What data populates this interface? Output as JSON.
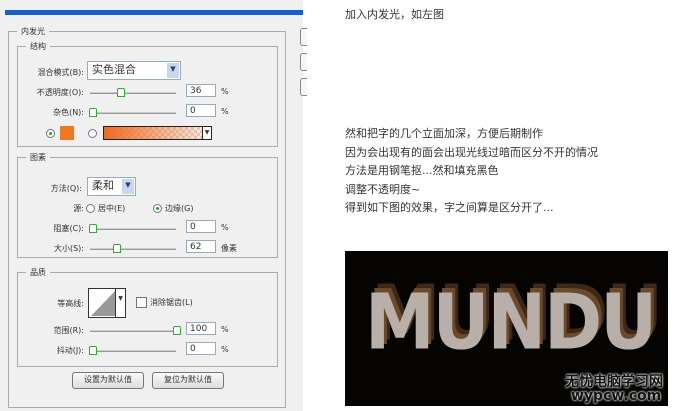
{
  "intro": "加入内发光，如左图",
  "dialog": {
    "title": "内发光",
    "structure": {
      "title": "结构",
      "blend_mode_label": "混合模式(B):",
      "blend_mode": "实色混合",
      "opacity_label": "不透明度(O):",
      "opacity": "36",
      "opacity_fraction": 0.36,
      "noise_label": "杂色(N):",
      "noise": "0",
      "unit": "%",
      "color": "#f07820"
    },
    "elements": {
      "title": "图素",
      "method_label": "方法(Q):",
      "method": "柔和",
      "source_label": "源:",
      "center_label": "居中(E)",
      "edge_label": "边缘(G)",
      "choke_label": "阻塞(C):",
      "choke": "0",
      "size_label": "大小(S):",
      "size": "62",
      "size_unit": "像素",
      "unit": "%"
    },
    "quality": {
      "title": "品质",
      "contour_label": "等高线:",
      "antialias_label": "消除锯齿(L)",
      "range_label": "范围(R):",
      "range": "100",
      "jitter_label": "抖动(J):",
      "jitter": "0",
      "unit": "%"
    },
    "set_default": "设置为默认值",
    "reset_default": "复位为默认值"
  },
  "paragraph": [
    "然和把字的几个立面加深，方便后期制作",
    "因为会出现有的面会出现光线过暗而区分不开的情况",
    "方法是用钢笔抠...然和填充黑色",
    "调整不透明度~",
    "得到如下图的效果，字之间算是区分开了..."
  ],
  "image": {
    "text": "MUNDU",
    "watermark_cn": "无忧电脑学习网",
    "watermark_url": "wypcw.com"
  }
}
